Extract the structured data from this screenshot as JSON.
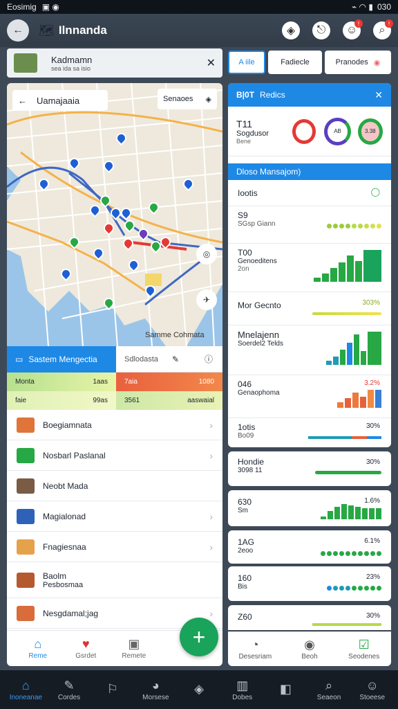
{
  "status": {
    "left": "Eosimig",
    "right": "030"
  },
  "appbar": {
    "title": "Ilnnanda",
    "logo": "🗺",
    "back": "←"
  },
  "banner": {
    "title": "Kadmamn",
    "subtitle": "sea ida sa isio",
    "close": "✕"
  },
  "tabs": [
    {
      "label": "A iile"
    },
    {
      "label": "Fadiecle"
    },
    {
      "label": "Pranodes"
    }
  ],
  "map": {
    "title": "Uamajaaia",
    "search": "Senaoes",
    "caption": "Samme Cohmata",
    "back": "←"
  },
  "panel_left": {
    "tab_active": "Sastem Mengectia",
    "tab_other": "Sdlodasta",
    "grid": [
      [
        "Monta",
        "1aas"
      ],
      [
        "7aia",
        "1080"
      ],
      [
        "faie",
        "99as"
      ],
      [
        "3561",
        "aaswaial"
      ]
    ],
    "items": [
      "Boegiamnata",
      "Nosbarl Paslanal",
      "Neobt Mada",
      "Magialonad",
      "Fnagiesnaa",
      "Baolm",
      "Nesgdamal;jag"
    ],
    "items_sub": [
      "",
      "",
      "",
      "",
      "",
      "Pesbosmaa",
      ""
    ],
    "bottom": [
      "Reme",
      "Gsrdet",
      "Remete"
    ],
    "fab": "+"
  },
  "panel_right": {
    "header": "Redics",
    "header_badge": "B|0T",
    "close": "✕",
    "ring": {
      "title": "T11",
      "sub1": "Sogdusor",
      "sub2": "Bene",
      "r1": "",
      "r2": "AB",
      "r3": "3.38"
    },
    "blue_title": "Dloso Mansajom)",
    "stats": [
      {
        "t": "Iootis",
        "s": "",
        "v": ""
      },
      {
        "t": "S9",
        "s": "SGsp Giann",
        "v": ""
      },
      {
        "t": "T00",
        "s": "Genoeditens",
        "s2": "2on",
        "v": ""
      },
      {
        "t": "Mor Gecnto",
        "s": "",
        "v": "303%"
      },
      {
        "t": "Mnelajenn",
        "s": "Soerdel2 Telds",
        "v": ""
      },
      {
        "t": "046",
        "s": "Genaophoma",
        "v": "3.2%"
      },
      {
        "t": "1otis",
        "s": "Bo09",
        "v": "30%"
      }
    ],
    "cards": [
      {
        "t": "Hondie",
        "s": "3098 11",
        "v": "30%"
      },
      {
        "t": "630",
        "s": "Sm",
        "v": "1.6%"
      },
      {
        "t": "1AG",
        "s": "2eoo",
        "v": "6.1%"
      },
      {
        "t": "160",
        "s": "Bis",
        "v": "23%"
      },
      {
        "t": "Z60",
        "s": "",
        "v": "30%"
      }
    ],
    "bottom": [
      "Desesriam",
      "Beoh",
      "Seodenes"
    ]
  },
  "nav": [
    "Inoneanae",
    "Cordes",
    "",
    "Morsese",
    "",
    "Dobes",
    "",
    "Seaeon",
    "Stoeese"
  ],
  "colors": {
    "accent": "#1e88e5",
    "green": "#27a844",
    "red": "#e53935"
  }
}
